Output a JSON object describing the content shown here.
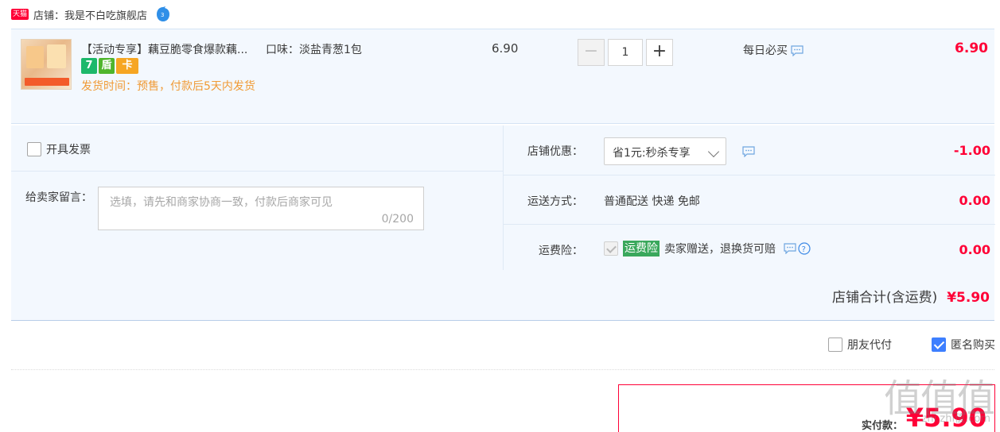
{
  "shop": {
    "badge": "天猫",
    "name": "店铺：我是不白吃旗舰店"
  },
  "item": {
    "title": "【活动专享】藕豆脆零食爆款藕...",
    "sku": "口味：淡盐青葱1包",
    "badges": [
      "7",
      "盾",
      "卡"
    ],
    "ship_time": "发货时间：预售，付款后5天内发货",
    "unit_price": "6.90",
    "quantity": "1",
    "qty_minus": "−",
    "qty_plus": "+",
    "daily_label": "每日必买",
    "total": "6.90"
  },
  "order": {
    "invoice_label": "开具发票",
    "memo_label": "给卖家留言：",
    "memo_placeholder": "选填，请先和商家协商一致，付款后商家可见",
    "memo_count": "0/200",
    "discount_label": "店铺优惠：",
    "discount_value": "省1元:秒杀专享",
    "discount_amount": "-1.00",
    "ship_label": "运送方式：",
    "ship_value": "普通配送 快递 免邮",
    "ship_amount": "0.00",
    "insurance_label": "运费险：",
    "insurance_badge": "运费险",
    "insurance_desc": "卖家赠送，退换货可赔",
    "insurance_amount": "0.00",
    "shop_total_label": "店铺合计(含运费)",
    "shop_total_value": "¥5.90"
  },
  "options": {
    "friend_pay_label": "朋友代付",
    "anonymous_label": "匿名购买",
    "anonymous_checked": true
  },
  "payment": {
    "label": "实付款：",
    "value": "¥5.90"
  },
  "watermark": {
    "text": "值值值",
    "url": "zhi.zhi值.com"
  },
  "colors": {
    "accent_red": "#ff0036",
    "panel_blue": "#f3f8fe",
    "ship_orange": "#f09a35",
    "insurance_green": "#3aa85c",
    "checkbox_blue": "#3d7fff"
  }
}
